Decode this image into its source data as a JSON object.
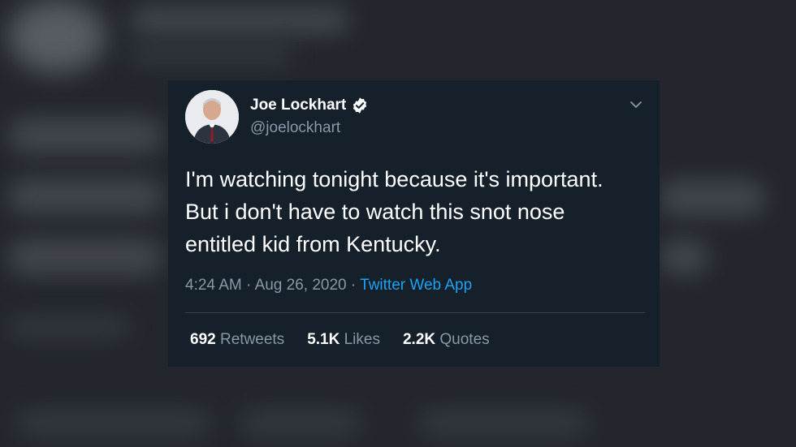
{
  "tweet": {
    "author_name": "Joe Lockhart",
    "handle": "@joelockhart",
    "verified": true,
    "text": "I'm watching tonight because it's important. But i don't have to watch this snot nose entitled kid from Kentucky.",
    "time": "4:24 AM",
    "separator": "·",
    "date": "Aug 26, 2020",
    "app": "Twitter Web App",
    "stats": {
      "retweets_count": "692",
      "retweets_label": "Retweets",
      "likes_count": "5.1K",
      "likes_label": "Likes",
      "quotes_count": "2.2K",
      "quotes_label": "Quotes"
    }
  },
  "colors": {
    "card_bg": "#15202b",
    "secondary_text": "#8899a6",
    "link_blue": "#1da1f2",
    "divider": "#38444d"
  }
}
